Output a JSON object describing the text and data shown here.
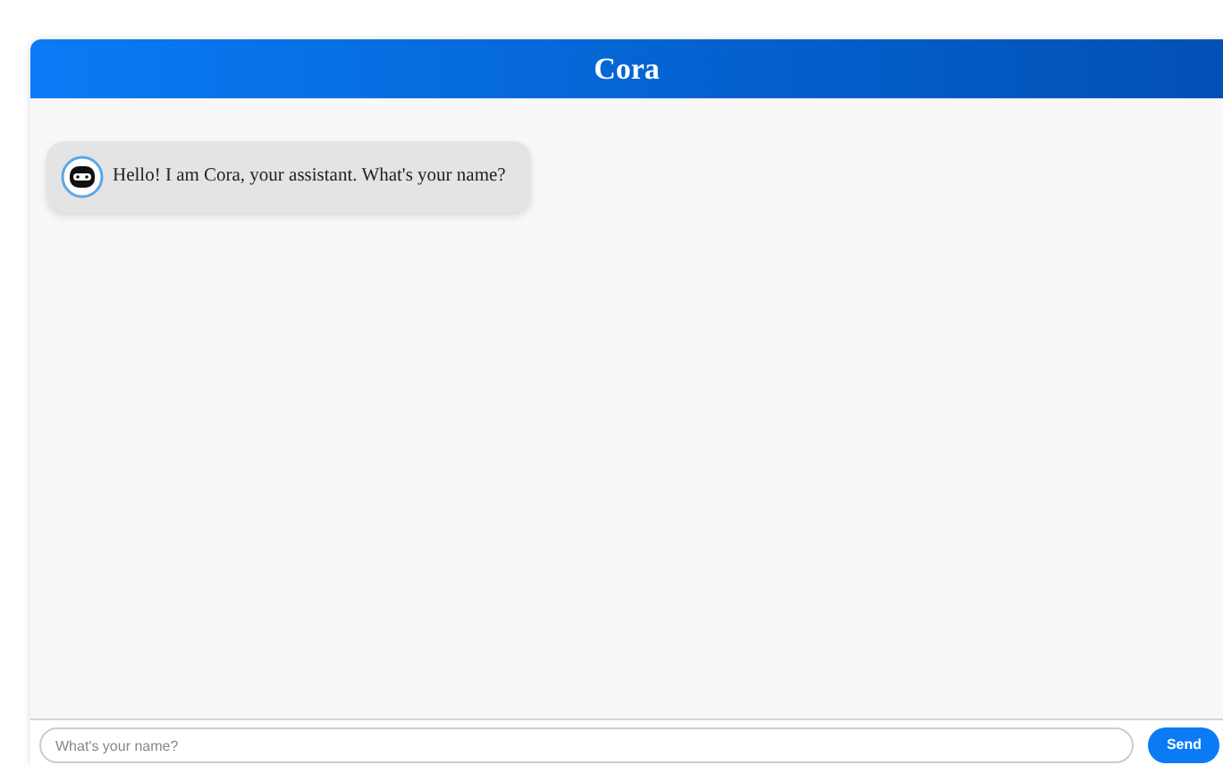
{
  "header": {
    "title": "Cora"
  },
  "messages": [
    {
      "kind": "bot",
      "text": "Hello! I am Cora, your assistant. What's your name?"
    }
  ],
  "composer": {
    "placeholder": "What's your name?",
    "send_label": "Send"
  }
}
